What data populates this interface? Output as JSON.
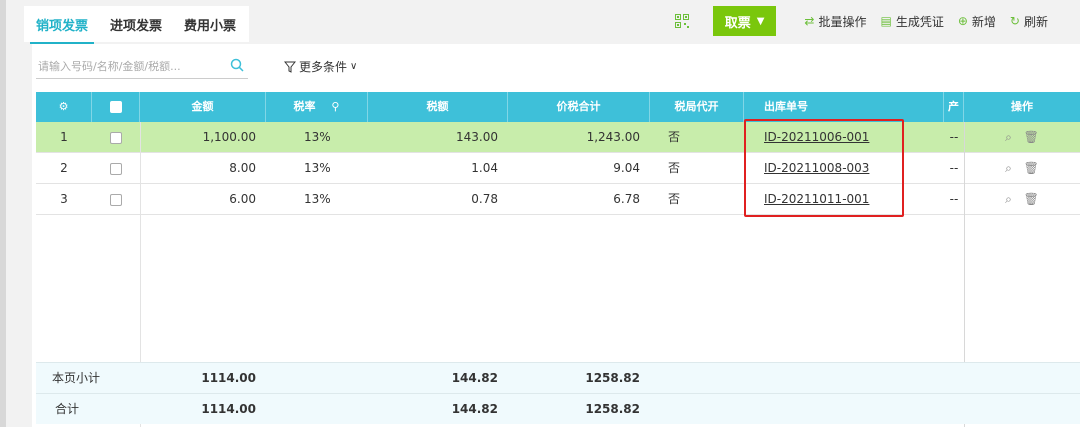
{
  "tabs": [
    {
      "label": "销项发票",
      "active": true
    },
    {
      "label": "进项发票",
      "active": false
    },
    {
      "label": "费用小票",
      "active": false
    }
  ],
  "toolbar": {
    "ticket_button": "取票",
    "batch_label": "批量操作",
    "voucher_label": "生成凭证",
    "add_label": "新增",
    "refresh_label": "刷新"
  },
  "search": {
    "placeholder": "请输入号码/名称/金额/税额...",
    "more_label": "更多条件"
  },
  "columns": {
    "amount": "金额",
    "tax_rate": "税率",
    "tax": "税额",
    "total": "价税合计",
    "tax_agency": "税局代开",
    "outbound_no": "出库单号",
    "product": "产",
    "actions": "操作"
  },
  "rows": [
    {
      "index": "1",
      "amount": "1,100.00",
      "tax_rate": "13%",
      "tax": "143.00",
      "total": "1,243.00",
      "agency": "否",
      "outbound": "ID-20211006-001",
      "product": "--"
    },
    {
      "index": "2",
      "amount": "8.00",
      "tax_rate": "13%",
      "tax": "1.04",
      "total": "9.04",
      "agency": "否",
      "outbound": "ID-20211008-003",
      "product": "--"
    },
    {
      "index": "3",
      "amount": "6.00",
      "tax_rate": "13%",
      "tax": "0.78",
      "total": "6.78",
      "agency": "否",
      "outbound": "ID-20211011-001",
      "product": "--"
    }
  ],
  "summary": {
    "page_label": "本页小计",
    "page_amount": "1114.00",
    "page_tax": "144.82",
    "page_total": "1258.82",
    "all_label": "合计",
    "all_amount": "1114.00",
    "all_tax": "144.82",
    "all_total": "1258.82"
  },
  "colors": {
    "accent": "#21b2c8",
    "header_bg": "#3ec0d9",
    "ticket_green": "#7ac70c",
    "selected_row": "#c8edab",
    "highlight_box": "#e02020"
  },
  "icons": [
    "qr-code-icon",
    "chevron-down-icon",
    "batch-icon",
    "voucher-icon",
    "add-circle-icon",
    "refresh-icon",
    "search-icon",
    "filter-icon",
    "gear-icon",
    "column-filter-icon",
    "view-icon",
    "trash-icon"
  ]
}
